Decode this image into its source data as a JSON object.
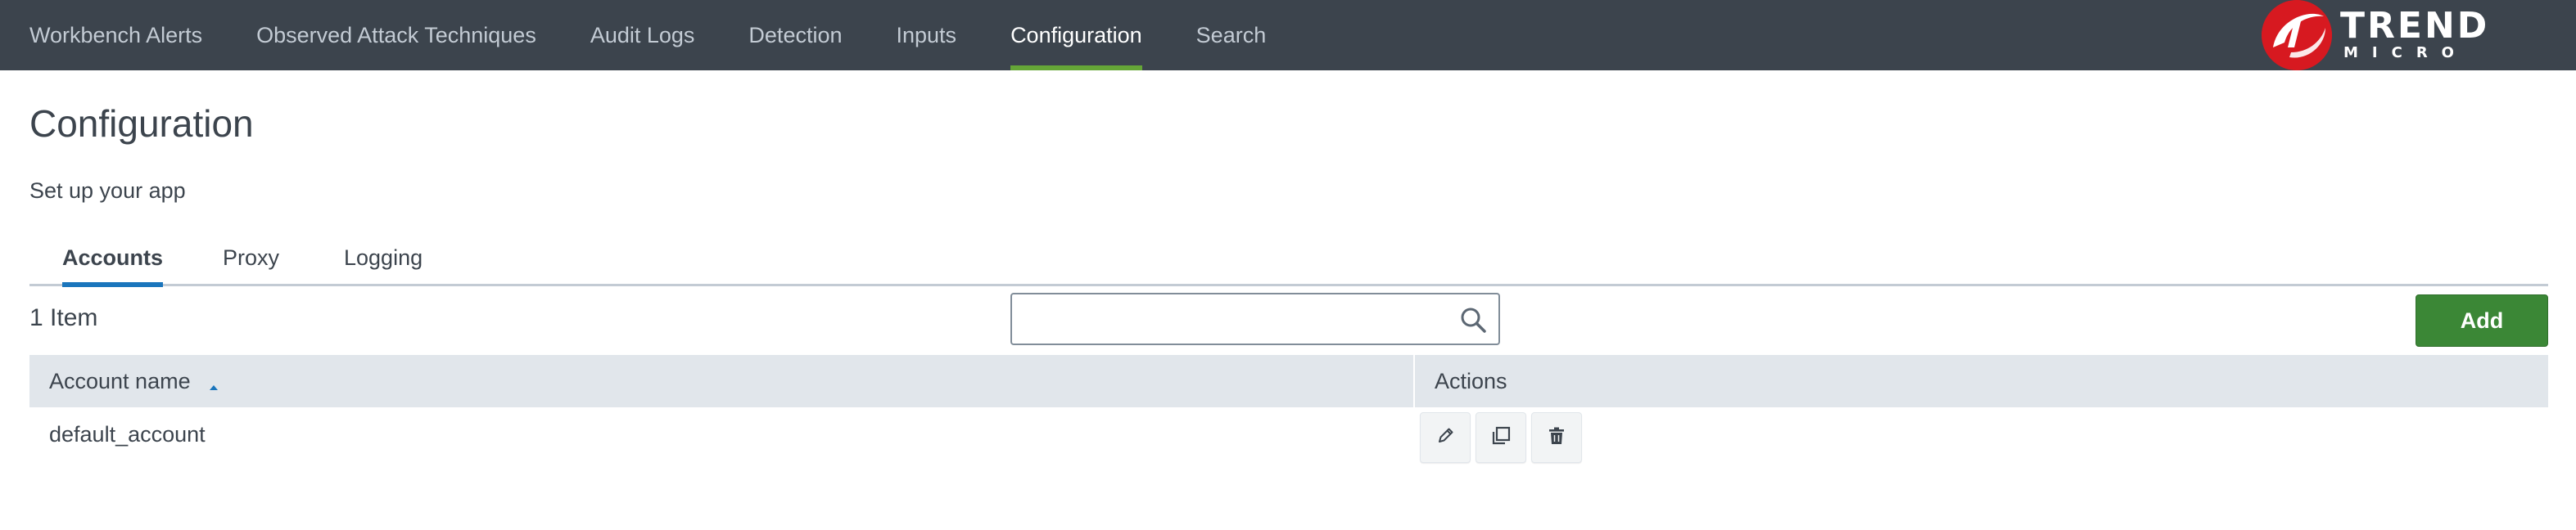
{
  "nav": {
    "items": [
      {
        "label": "Workbench Alerts",
        "active": false
      },
      {
        "label": "Observed Attack Techniques",
        "active": false
      },
      {
        "label": "Audit Logs",
        "active": false
      },
      {
        "label": "Detection",
        "active": false
      },
      {
        "label": "Inputs",
        "active": false
      },
      {
        "label": "Configuration",
        "active": true
      },
      {
        "label": "Search",
        "active": false
      }
    ],
    "brand": {
      "logo_icon": "trend-micro-logo-icon",
      "word1": "TREND",
      "word2": "MICRO"
    }
  },
  "page": {
    "title": "Configuration",
    "subtitle": "Set up your app"
  },
  "tabs": [
    {
      "label": "Accounts",
      "active": true
    },
    {
      "label": "Proxy",
      "active": false
    },
    {
      "label": "Logging",
      "active": false
    }
  ],
  "toolbar": {
    "item_count": "1 Item",
    "search": {
      "value": "",
      "placeholder": "",
      "icon": "search-icon"
    },
    "add_label": "Add"
  },
  "table": {
    "columns": [
      {
        "label": "Account name",
        "sort": "ascending"
      },
      {
        "label": "Actions"
      }
    ],
    "rows": [
      {
        "account_name": "default_account",
        "actions": [
          "edit-icon",
          "clone-icon",
          "delete-icon"
        ]
      }
    ]
  },
  "colors": {
    "nav_background": "#3c444d",
    "nav_active_underline": "#65a637",
    "tab_active_underline": "#1a75bc",
    "add_button": "#3b8736",
    "table_header": "#e1e6eb",
    "brand_red": "#d71920"
  }
}
